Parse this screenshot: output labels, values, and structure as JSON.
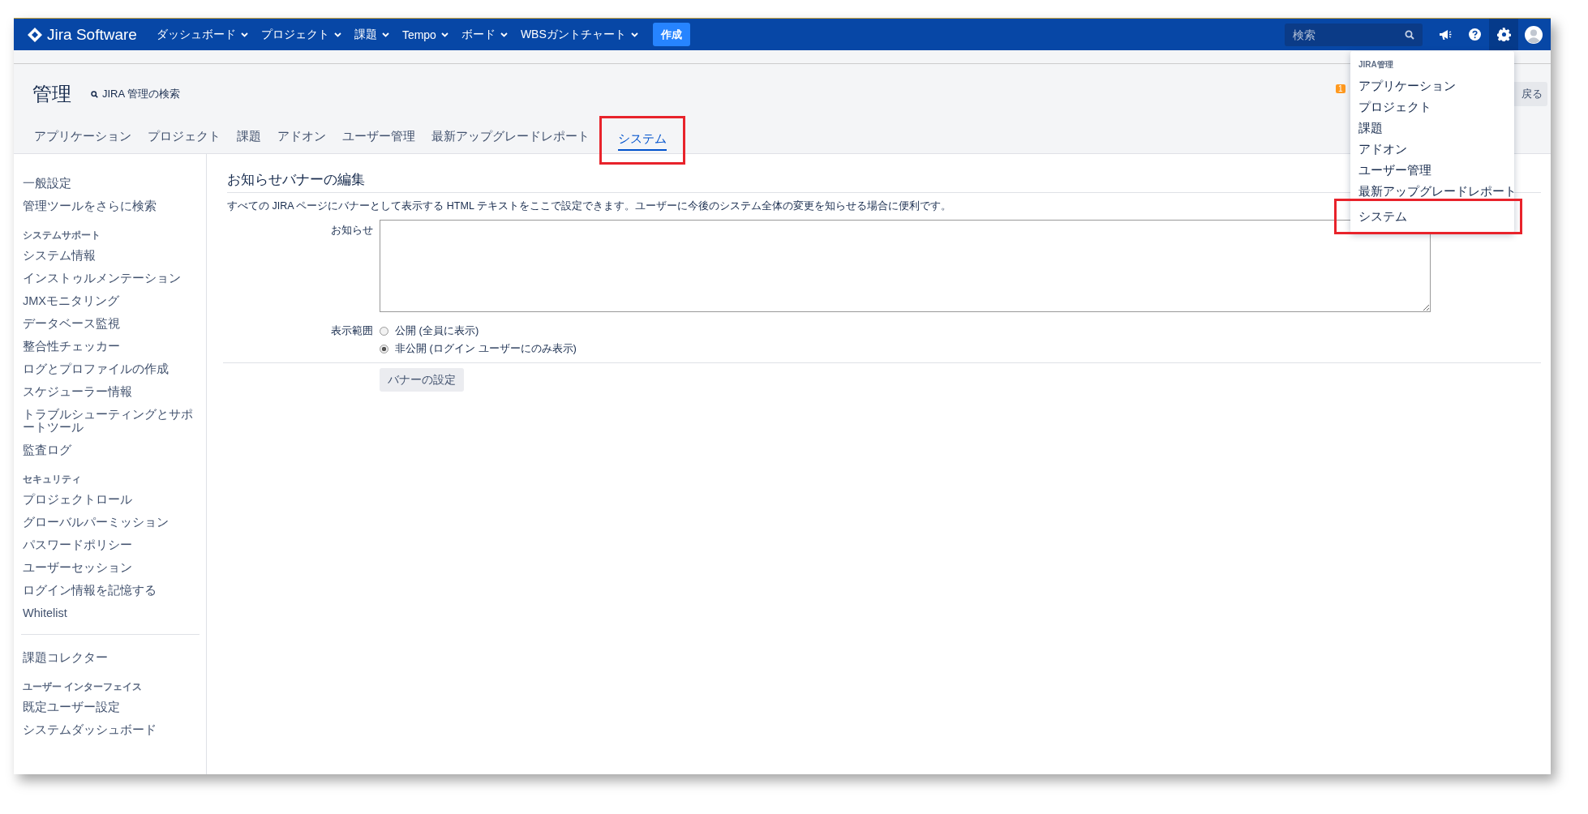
{
  "nav": {
    "logo": "Jira Software",
    "menus": [
      {
        "label": "ダッシュボード"
      },
      {
        "label": "プロジェクト"
      },
      {
        "label": "課題"
      },
      {
        "label": "Tempo"
      },
      {
        "label": "ボード"
      },
      {
        "label": "WBSガントチャート"
      }
    ],
    "create_button": "作成",
    "search": {
      "placeholder": "検索"
    }
  },
  "admin_menu": {
    "open": true,
    "heading": "JIRA管理",
    "items": [
      {
        "label": "アプリケーション",
        "highlighted": false
      },
      {
        "label": "プロジェクト",
        "highlighted": false
      },
      {
        "label": "課題",
        "highlighted": false
      },
      {
        "label": "アドオン",
        "highlighted": false
      },
      {
        "label": "ユーザー管理",
        "highlighted": false
      },
      {
        "label": "最新アップグレードレポート",
        "highlighted": false
      },
      {
        "label": "システム",
        "highlighted": true
      }
    ]
  },
  "header": {
    "title": "管理",
    "search_link": "JIRA 管理の検索",
    "notification_badge": "1",
    "back_button": "戻る"
  },
  "tabs": [
    {
      "label": "アプリケーション",
      "selected": false,
      "highlighted": false
    },
    {
      "label": "プロジェクト",
      "selected": false,
      "highlighted": false
    },
    {
      "label": "課題",
      "selected": false,
      "highlighted": false
    },
    {
      "label": "アドオン",
      "selected": false,
      "highlighted": false
    },
    {
      "label": "ユーザー管理",
      "selected": false,
      "highlighted": false
    },
    {
      "label": "最新アップグレードレポート",
      "selected": false,
      "highlighted": false
    },
    {
      "label": "システム",
      "selected": true,
      "highlighted": true
    }
  ],
  "sidebar": {
    "groups": [
      {
        "sections": [
          {
            "items": [
              "一般設定",
              "管理ツールをさらに検索"
            ]
          },
          {
            "heading": "システムサポート",
            "items": [
              "システム情報",
              "インストゥルメンテーション",
              "JMXモニタリング",
              "データベース監視",
              "整合性チェッカー",
              "ログとプロファイルの作成",
              "スケジューラー情報",
              "トラブルシューティングとサポートツール",
              "監査ログ"
            ]
          },
          {
            "heading": "セキュリティ",
            "items": [
              "プロジェクトロール",
              "グローバルパーミッション",
              "パスワードポリシー",
              "ユーザーセッション",
              "ログイン情報を記憶する",
              "Whitelist"
            ]
          }
        ]
      },
      {
        "sections": [
          {
            "items": [
              "課題コレクター"
            ]
          },
          {
            "heading": "ユーザー インターフェイス",
            "items": [
              "既定ユーザー設定",
              "システムダッシュボード"
            ]
          }
        ]
      }
    ]
  },
  "main": {
    "heading": "お知らせバナーの編集",
    "description": "すべての JIRA ページにバナーとして表示する HTML テキストをここで設定できます。ユーザーに今後のシステム全体の変更を知らせる場合に便利です。",
    "announcement_label": "お知らせ",
    "visibility_label": "表示範囲",
    "visibility_options": [
      {
        "label": "公開 (全員に表示)",
        "selected": false
      },
      {
        "label": "非公開 (ログイン ユーザーにのみ表示)",
        "selected": true
      }
    ],
    "submit_button": "バナーの設定"
  }
}
